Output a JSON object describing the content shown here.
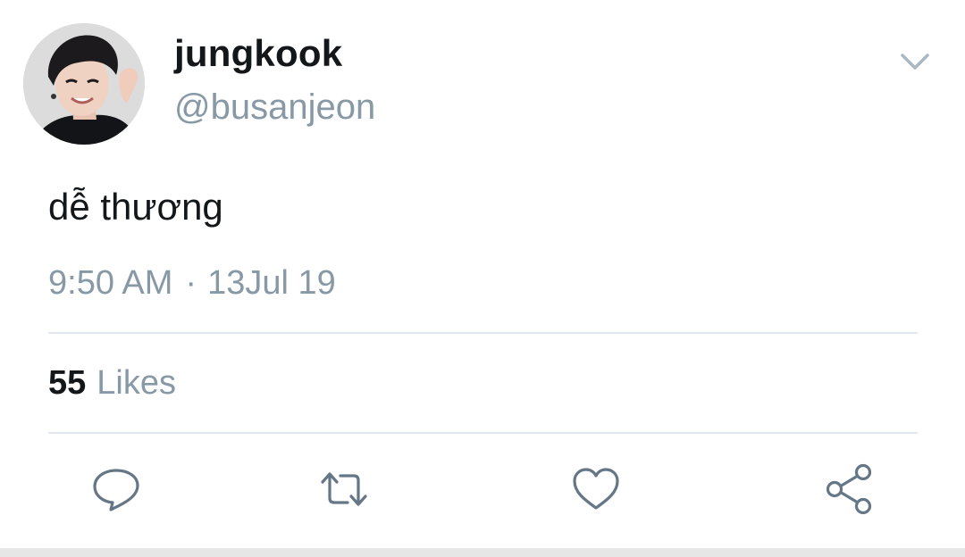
{
  "author": {
    "display_name": "jungkook",
    "handle": "@busanjeon",
    "avatar_icon": "profile-photo"
  },
  "tweet": {
    "text": "dễ thương",
    "time": "9:50 AM",
    "separator": "·",
    "date": "13Jul 19"
  },
  "stats": {
    "likes_count": "55",
    "likes_label": "Likes"
  },
  "actions": {
    "reply_icon": "reply-icon",
    "retweet_icon": "retweet-icon",
    "like_icon": "heart-icon",
    "share_icon": "share-icon",
    "menu_icon": "chevron-down-icon"
  },
  "colors": {
    "primary_text": "#14171a",
    "secondary_text": "#8899a6",
    "divider": "#e1e8ed",
    "icon": "#657786"
  }
}
